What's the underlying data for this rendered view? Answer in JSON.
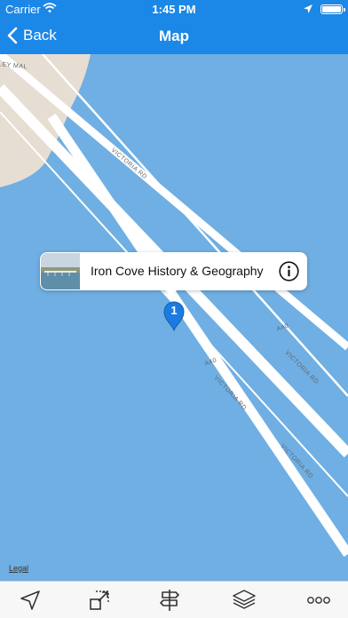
{
  "status_bar": {
    "carrier": "Carrier",
    "time": "1:45 PM",
    "icons": [
      "wifi-icon",
      "location-arrow-icon",
      "battery-icon"
    ]
  },
  "nav": {
    "back_label": "Back",
    "title": "Map"
  },
  "map": {
    "road_labels": [
      "VICTORIA RD",
      "VICTORIA RD",
      "VICTORIA RD",
      "A40",
      "A40",
      "VICTORIA RD"
    ],
    "street_fragment": "LEY MAL",
    "legal_label": "Legal",
    "colors": {
      "water": "#6fafe3",
      "land": "#e6ddd3",
      "road": "#ffffff"
    }
  },
  "callout": {
    "title": "Iron Cove History & Geography",
    "icon": "info-icon"
  },
  "pin": {
    "label": "1",
    "color": "#1b7be0"
  },
  "toolbar": {
    "items": [
      {
        "name": "locate-icon"
      },
      {
        "name": "zoom-to-fit-icon"
      },
      {
        "name": "directions-signpost-icon"
      },
      {
        "name": "map-layers-icon"
      },
      {
        "name": "more-icon"
      }
    ]
  },
  "accent": "#1b87e6"
}
